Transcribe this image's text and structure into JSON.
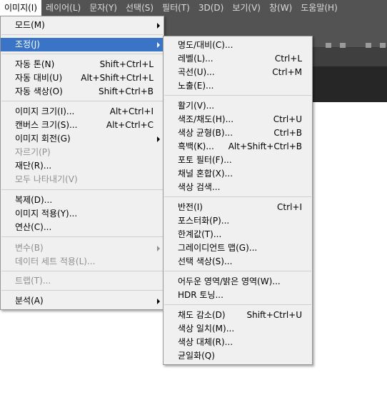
{
  "menubar": {
    "items": [
      "이미지(I)",
      "레이어(L)",
      "문자(Y)",
      "선택(S)",
      "필터(T)",
      "3D(D)",
      "보기(V)",
      "창(W)",
      "도움말(H)"
    ]
  },
  "image_menu": {
    "mode": "모드(M)",
    "adjustments": "조정(J)",
    "auto_tone": {
      "label": "자동 톤(N)",
      "shortcut": "Shift+Ctrl+L"
    },
    "auto_contrast": {
      "label": "자동 대비(U)",
      "shortcut": "Alt+Shift+Ctrl+L"
    },
    "auto_color": {
      "label": "자동 색상(O)",
      "shortcut": "Shift+Ctrl+B"
    },
    "image_size": {
      "label": "이미지 크기(I)...",
      "shortcut": "Alt+Ctrl+I"
    },
    "canvas_size": {
      "label": "캔버스 크기(S)...",
      "shortcut": "Alt+Ctrl+C"
    },
    "image_rotation": "이미지 회전(G)",
    "crop": "자르기(P)",
    "trim": "재단(R)...",
    "reveal_all": "모두 나타내기(V)",
    "duplicate": "복제(D)...",
    "apply_image": "이미지 적용(Y)...",
    "calculations": "연산(C)...",
    "variables": "변수(B)",
    "apply_data_set": "데이터 세트 적용(L)...",
    "trap": "트랩(T)...",
    "analysis": "분석(A)"
  },
  "adjust_menu": {
    "brightness_contrast": "명도/대비(C)...",
    "levels": {
      "label": "레벨(L)...",
      "shortcut": "Ctrl+L"
    },
    "curves": {
      "label": "곡선(U)...",
      "shortcut": "Ctrl+M"
    },
    "exposure": "노출(E)...",
    "vibrance": "활기(V)...",
    "hue_saturation": {
      "label": "색조/채도(H)...",
      "shortcut": "Ctrl+U"
    },
    "color_balance": {
      "label": "색상 균형(B)...",
      "shortcut": "Ctrl+B"
    },
    "black_white": {
      "label": "흑백(K)...",
      "shortcut": "Alt+Shift+Ctrl+B"
    },
    "photo_filter": "포토 필터(F)...",
    "channel_mixer": "채널 혼합(X)...",
    "color_lookup": "색상 검색...",
    "invert": {
      "label": "반전(I)",
      "shortcut": "Ctrl+I"
    },
    "posterize": "포스터화(P)...",
    "threshold": "한계값(T)...",
    "gradient_map": "그레이디언트 맵(G)...",
    "selective_color": "선택 색상(S)...",
    "shadows_highlights": "어두운 영역/밝은 영역(W)...",
    "hdr_toning": "HDR 토닝...",
    "desaturate": {
      "label": "채도 감소(D)",
      "shortcut": "Shift+Ctrl+U"
    },
    "match_color": "색상 일치(M)...",
    "replace_color": "색상 대체(R)...",
    "equalize": "균일화(Q)"
  }
}
